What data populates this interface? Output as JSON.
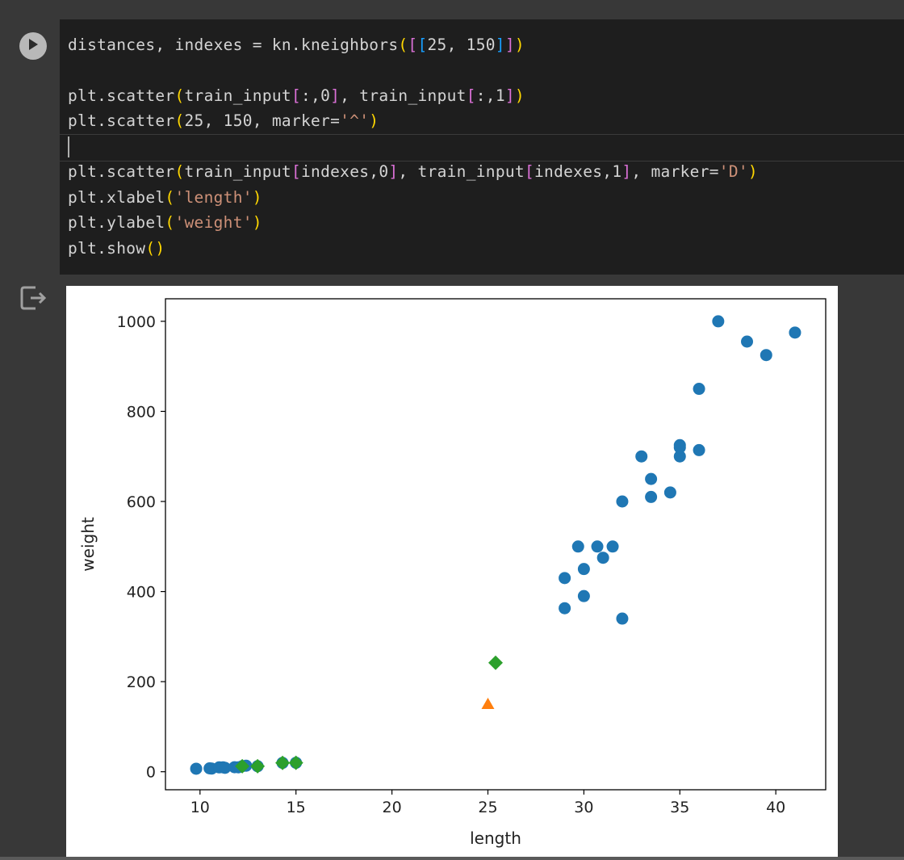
{
  "code_lines": [
    {
      "segments": [
        {
          "t": "distances, indexes = kn.kneighbors",
          "c": ""
        },
        {
          "t": "(",
          "c": "p1"
        },
        {
          "t": "[",
          "c": "p2"
        },
        {
          "t": "[",
          "c": "p3"
        },
        {
          "t": "25, 150",
          "c": ""
        },
        {
          "t": "]",
          "c": "p3"
        },
        {
          "t": "]",
          "c": "p2"
        },
        {
          "t": ")",
          "c": "p1"
        }
      ]
    },
    {
      "segments": []
    },
    {
      "segments": [
        {
          "t": "plt.scatter",
          "c": ""
        },
        {
          "t": "(",
          "c": "p1"
        },
        {
          "t": "train_input",
          "c": ""
        },
        {
          "t": "[",
          "c": "p2"
        },
        {
          "t": ":,0",
          "c": ""
        },
        {
          "t": "]",
          "c": "p2"
        },
        {
          "t": ", train_input",
          "c": ""
        },
        {
          "t": "[",
          "c": "p2"
        },
        {
          "t": ":,1",
          "c": ""
        },
        {
          "t": "]",
          "c": "p2"
        },
        {
          "t": ")",
          "c": "p1"
        }
      ]
    },
    {
      "segments": [
        {
          "t": "plt.scatter",
          "c": ""
        },
        {
          "t": "(",
          "c": "p1"
        },
        {
          "t": "25, 150, marker=",
          "c": ""
        },
        {
          "t": "'^'",
          "c": "str"
        },
        {
          "t": ")",
          "c": "p1"
        }
      ]
    },
    {
      "segments": []
    },
    {
      "segments": [
        {
          "t": "plt.scatter",
          "c": ""
        },
        {
          "t": "(",
          "c": "p1"
        },
        {
          "t": "train_input",
          "c": ""
        },
        {
          "t": "[",
          "c": "p2"
        },
        {
          "t": "indexes,0",
          "c": ""
        },
        {
          "t": "]",
          "c": "p2"
        },
        {
          "t": ", train_input",
          "c": ""
        },
        {
          "t": "[",
          "c": "p2"
        },
        {
          "t": "indexes,1",
          "c": ""
        },
        {
          "t": "]",
          "c": "p2"
        },
        {
          "t": ", marker=",
          "c": ""
        },
        {
          "t": "'D'",
          "c": "str"
        },
        {
          "t": ")",
          "c": "p1"
        }
      ]
    },
    {
      "segments": [
        {
          "t": "plt.xlabel",
          "c": ""
        },
        {
          "t": "(",
          "c": "p1"
        },
        {
          "t": "'length'",
          "c": "str"
        },
        {
          "t": ")",
          "c": "p1"
        }
      ]
    },
    {
      "segments": [
        {
          "t": "plt.ylabel",
          "c": ""
        },
        {
          "t": "(",
          "c": "p1"
        },
        {
          "t": "'weight'",
          "c": "str"
        },
        {
          "t": ")",
          "c": "p1"
        }
      ]
    },
    {
      "segments": [
        {
          "t": "plt.show",
          "c": ""
        },
        {
          "t": "(",
          "c": "p1"
        },
        {
          "t": ")",
          "c": "p1"
        }
      ]
    }
  ],
  "icons": {
    "run": "play-circle-icon",
    "output": "output-exit-icon"
  },
  "chart_data": {
    "type": "scatter",
    "xlabel": "length",
    "ylabel": "weight",
    "xlim": [
      8.2,
      42.6
    ],
    "ylim": [
      -40,
      1050
    ],
    "xticks": [
      10,
      15,
      20,
      25,
      30,
      35,
      40
    ],
    "yticks": [
      0,
      200,
      400,
      600,
      800,
      1000
    ],
    "series": [
      {
        "marker": "circle",
        "color": "#1f77b4",
        "points": [
          [
            9.8,
            6.7
          ],
          [
            10.5,
            7.5
          ],
          [
            10.6,
            7.0
          ],
          [
            11.0,
            9.7
          ],
          [
            11.2,
            9.8
          ],
          [
            11.3,
            8.7
          ],
          [
            11.8,
            10.0
          ],
          [
            12.0,
            9.8
          ],
          [
            12.2,
            12.2
          ],
          [
            12.4,
            13.4
          ],
          [
            13.0,
            12.2
          ],
          [
            14.3,
            19.7
          ],
          [
            15.0,
            19.9
          ],
          [
            29.0,
            430.0
          ],
          [
            29.0,
            363.0
          ],
          [
            29.7,
            500.0
          ],
          [
            30.0,
            450.0
          ],
          [
            30.0,
            390.0
          ],
          [
            30.7,
            500.0
          ],
          [
            31.0,
            475.0
          ],
          [
            31.5,
            500.0
          ],
          [
            32.0,
            340.0
          ],
          [
            32.0,
            600.0
          ],
          [
            33.0,
            700.0
          ],
          [
            33.5,
            610.0
          ],
          [
            33.5,
            650.0
          ],
          [
            34.5,
            620.0
          ],
          [
            35.0,
            700.0
          ],
          [
            35.0,
            720.0
          ],
          [
            35.0,
            725.0
          ],
          [
            36.0,
            714.0
          ],
          [
            36.0,
            850.0
          ],
          [
            37.0,
            1000.0
          ],
          [
            38.5,
            955.0
          ],
          [
            39.5,
            925.0
          ],
          [
            41.0,
            975.0
          ]
        ]
      },
      {
        "marker": "triangle",
        "color": "#ff7f0e",
        "points": [
          [
            25,
            150
          ]
        ]
      },
      {
        "marker": "diamond",
        "color": "#2ca02c",
        "points": [
          [
            25.4,
            242.0
          ],
          [
            15.0,
            19.9
          ],
          [
            14.3,
            19.7
          ],
          [
            13.0,
            12.2
          ],
          [
            12.2,
            12.2
          ]
        ]
      }
    ]
  }
}
